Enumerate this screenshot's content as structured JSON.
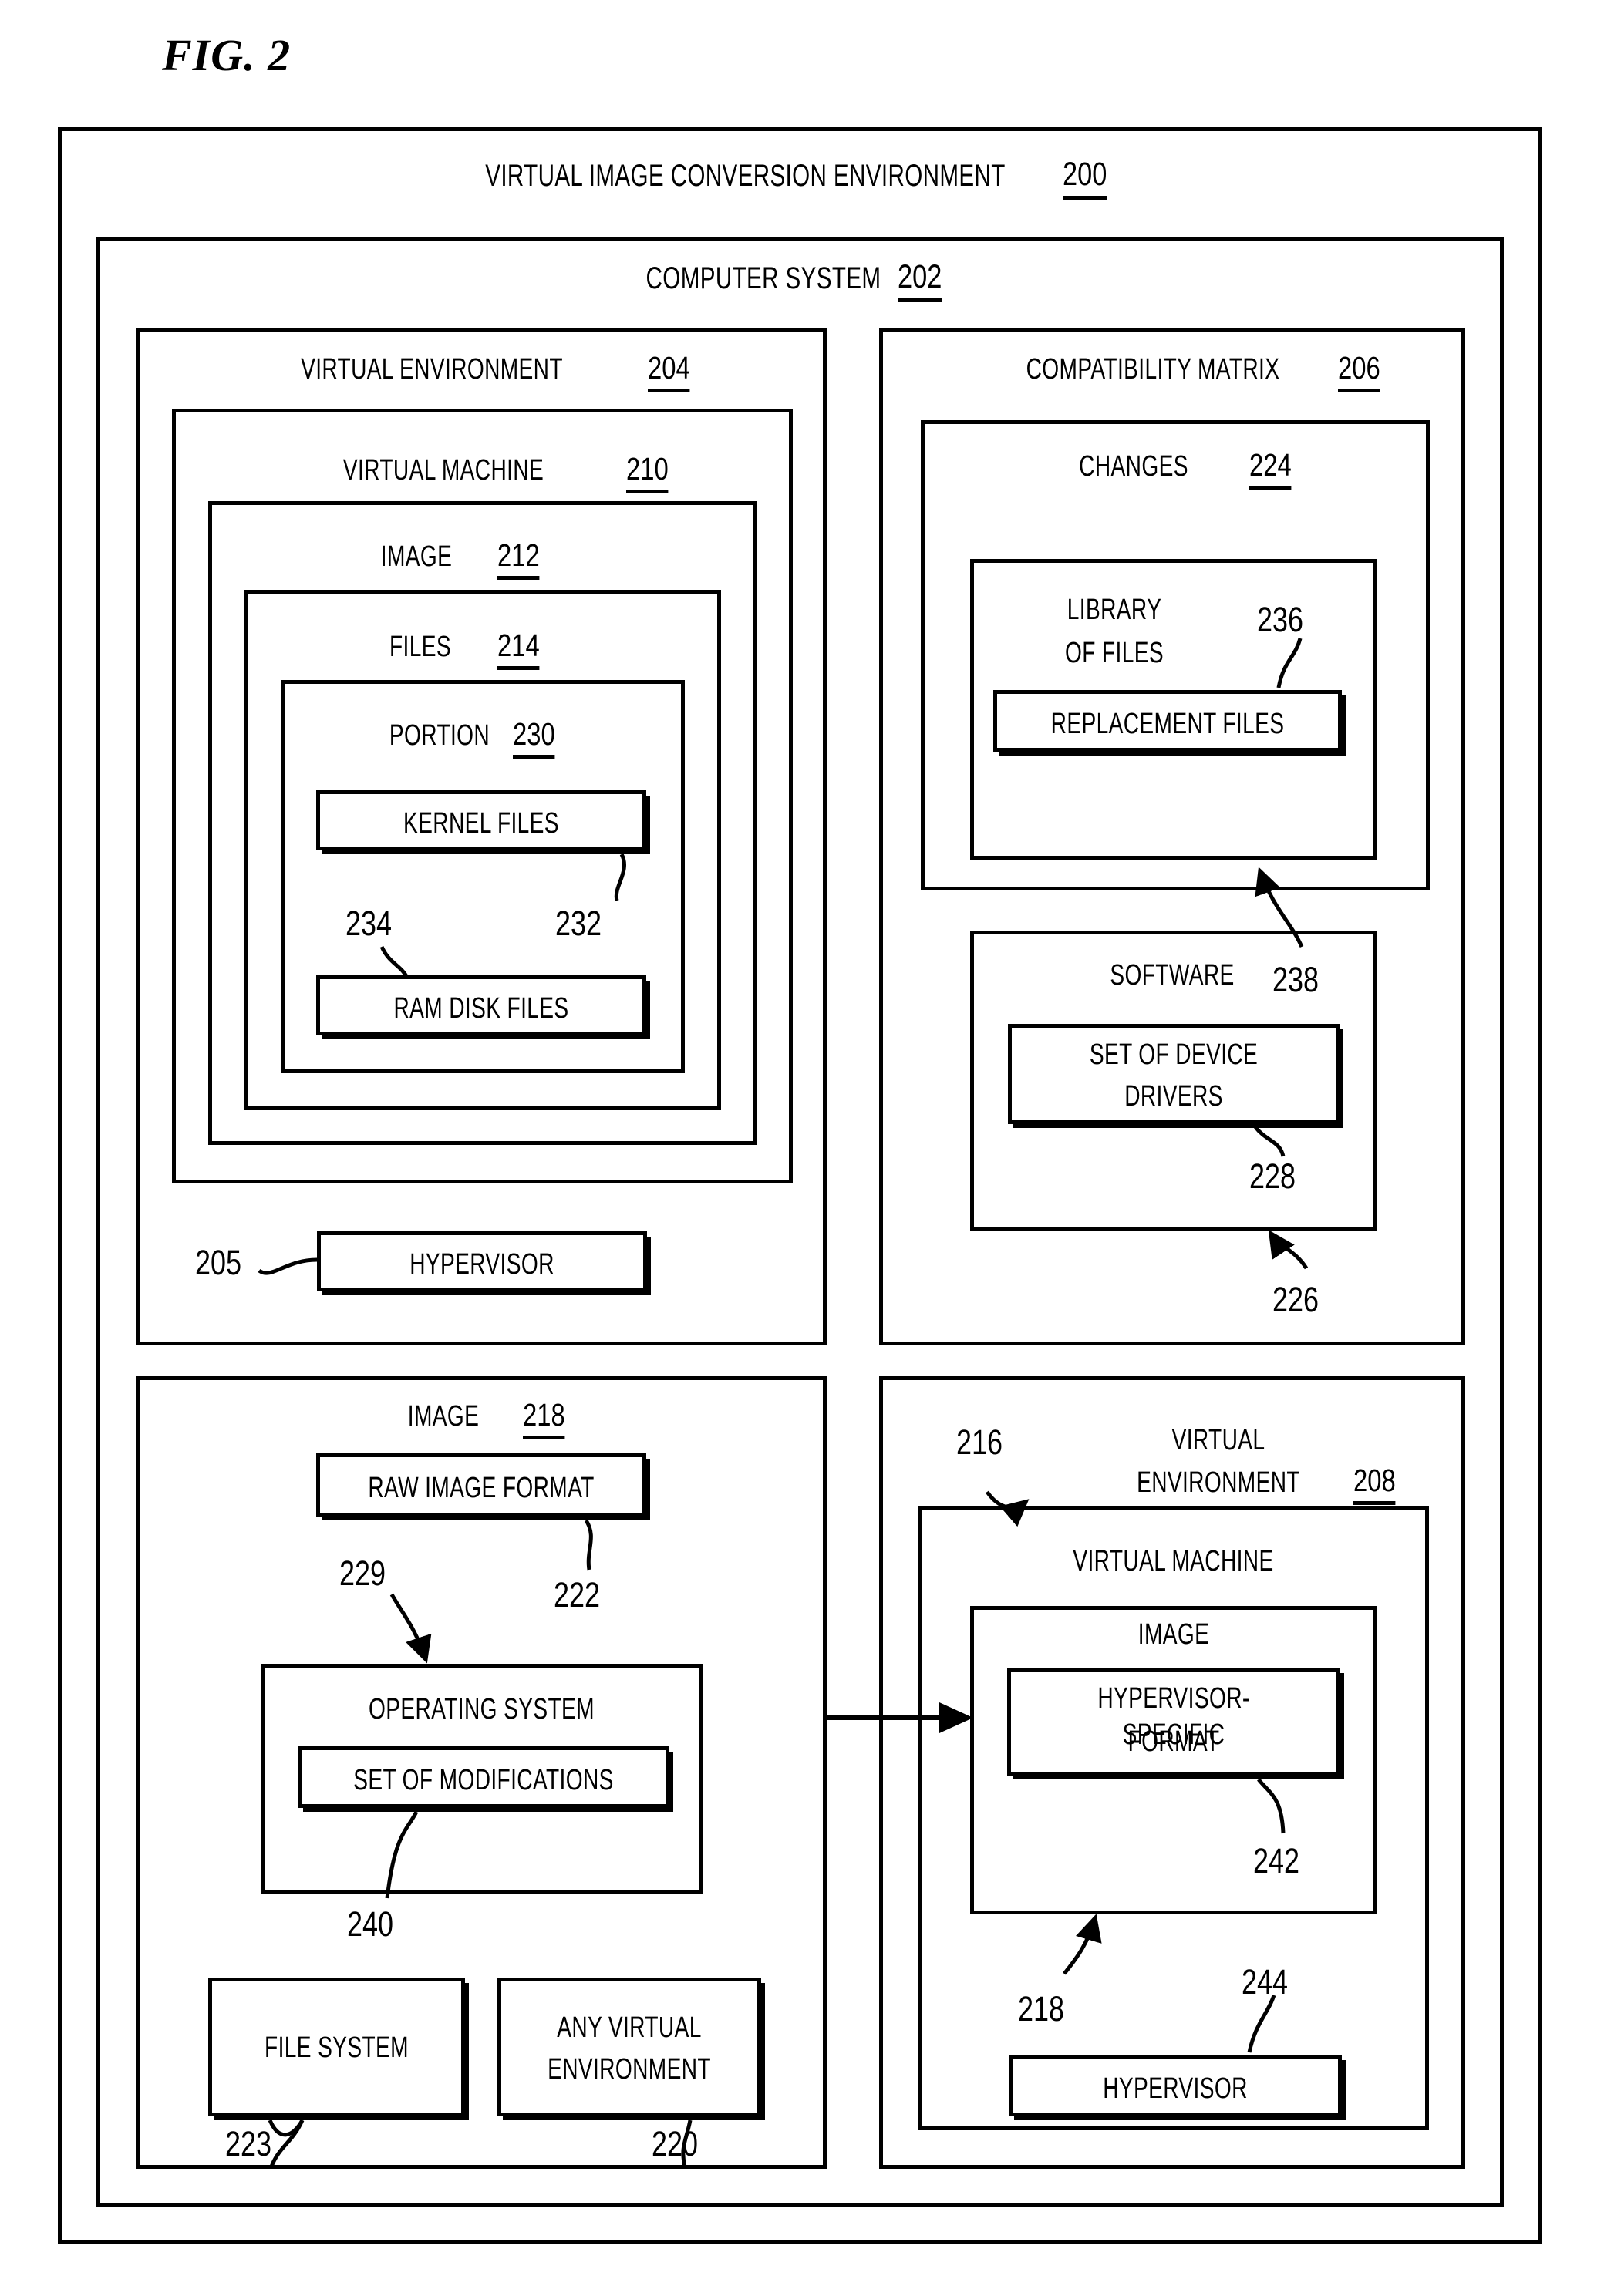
{
  "figure": {
    "label": "FIG. 2"
  },
  "outer": {
    "title": "VIRTUAL IMAGE CONVERSION ENVIRONMENT",
    "ref": "200"
  },
  "computer_system": {
    "title": "COMPUTER SYSTEM",
    "ref": "202"
  },
  "virtual_environment_source": {
    "title": "VIRTUAL ENVIRONMENT",
    "ref": "204",
    "virtual_machine": {
      "title": "VIRTUAL MACHINE",
      "ref": "210",
      "image": {
        "title": "IMAGE",
        "ref": "212",
        "files": {
          "title": "FILES",
          "ref": "214",
          "portion": {
            "title": "PORTION",
            "ref": "230",
            "kernel_files": "KERNEL FILES",
            "kernel_files_ref": "232",
            "ram_disk_files": "RAM DISK FILES",
            "ram_disk_files_ref": "234"
          }
        }
      }
    },
    "hypervisor": "HYPERVISOR",
    "hypervisor_ref": "205"
  },
  "compatibility_matrix": {
    "title": "COMPATIBILITY MATRIX",
    "ref": "206",
    "changes": {
      "title": "CHANGES",
      "ref": "224",
      "library_of_files_line1": "LIBRARY",
      "library_of_files_line2": "OF FILES",
      "library_of_files_ref": "236",
      "replacement_files": "REPLACEMENT FILES",
      "replacement_files_ref": "238"
    },
    "software": {
      "title": "SOFTWARE",
      "ref": "226",
      "set_of_device_drivers_line1": "SET OF DEVICE",
      "set_of_device_drivers_line2": "DRIVERS",
      "set_of_device_drivers_ref": "228"
    }
  },
  "image_source": {
    "title": "IMAGE",
    "ref": "218",
    "raw_image_format": "RAW IMAGE FORMAT",
    "raw_image_format_ref": "222",
    "operating_system": "OPERATING SYSTEM",
    "operating_system_ref": "229",
    "set_of_modifications": "SET OF MODIFICATIONS",
    "set_of_modifications_ref": "240",
    "file_system": "FILE SYSTEM",
    "file_system_ref": "223",
    "any_virtual_environment_line1": "ANY VIRTUAL",
    "any_virtual_environment_line2": "ENVIRONMENT",
    "any_virtual_environment_ref": "220"
  },
  "virtual_environment_target": {
    "title_line1": "VIRTUAL",
    "title_line2": "ENVIRONMENT",
    "ref": "208",
    "pointer_ref": "216",
    "virtual_machine": {
      "title": "VIRTUAL MACHINE",
      "image": {
        "title": "IMAGE",
        "image_ref": "218",
        "hypervisor_specific_format_line1": "HYPERVISOR-SPECIFIC",
        "hypervisor_specific_format_line2": "FORMAT",
        "hypervisor_specific_format_ref": "242"
      }
    },
    "hypervisor": "HYPERVISOR",
    "hypervisor_ref": "244"
  },
  "colors": {
    "ink": "#000000",
    "paper": "#ffffff"
  }
}
